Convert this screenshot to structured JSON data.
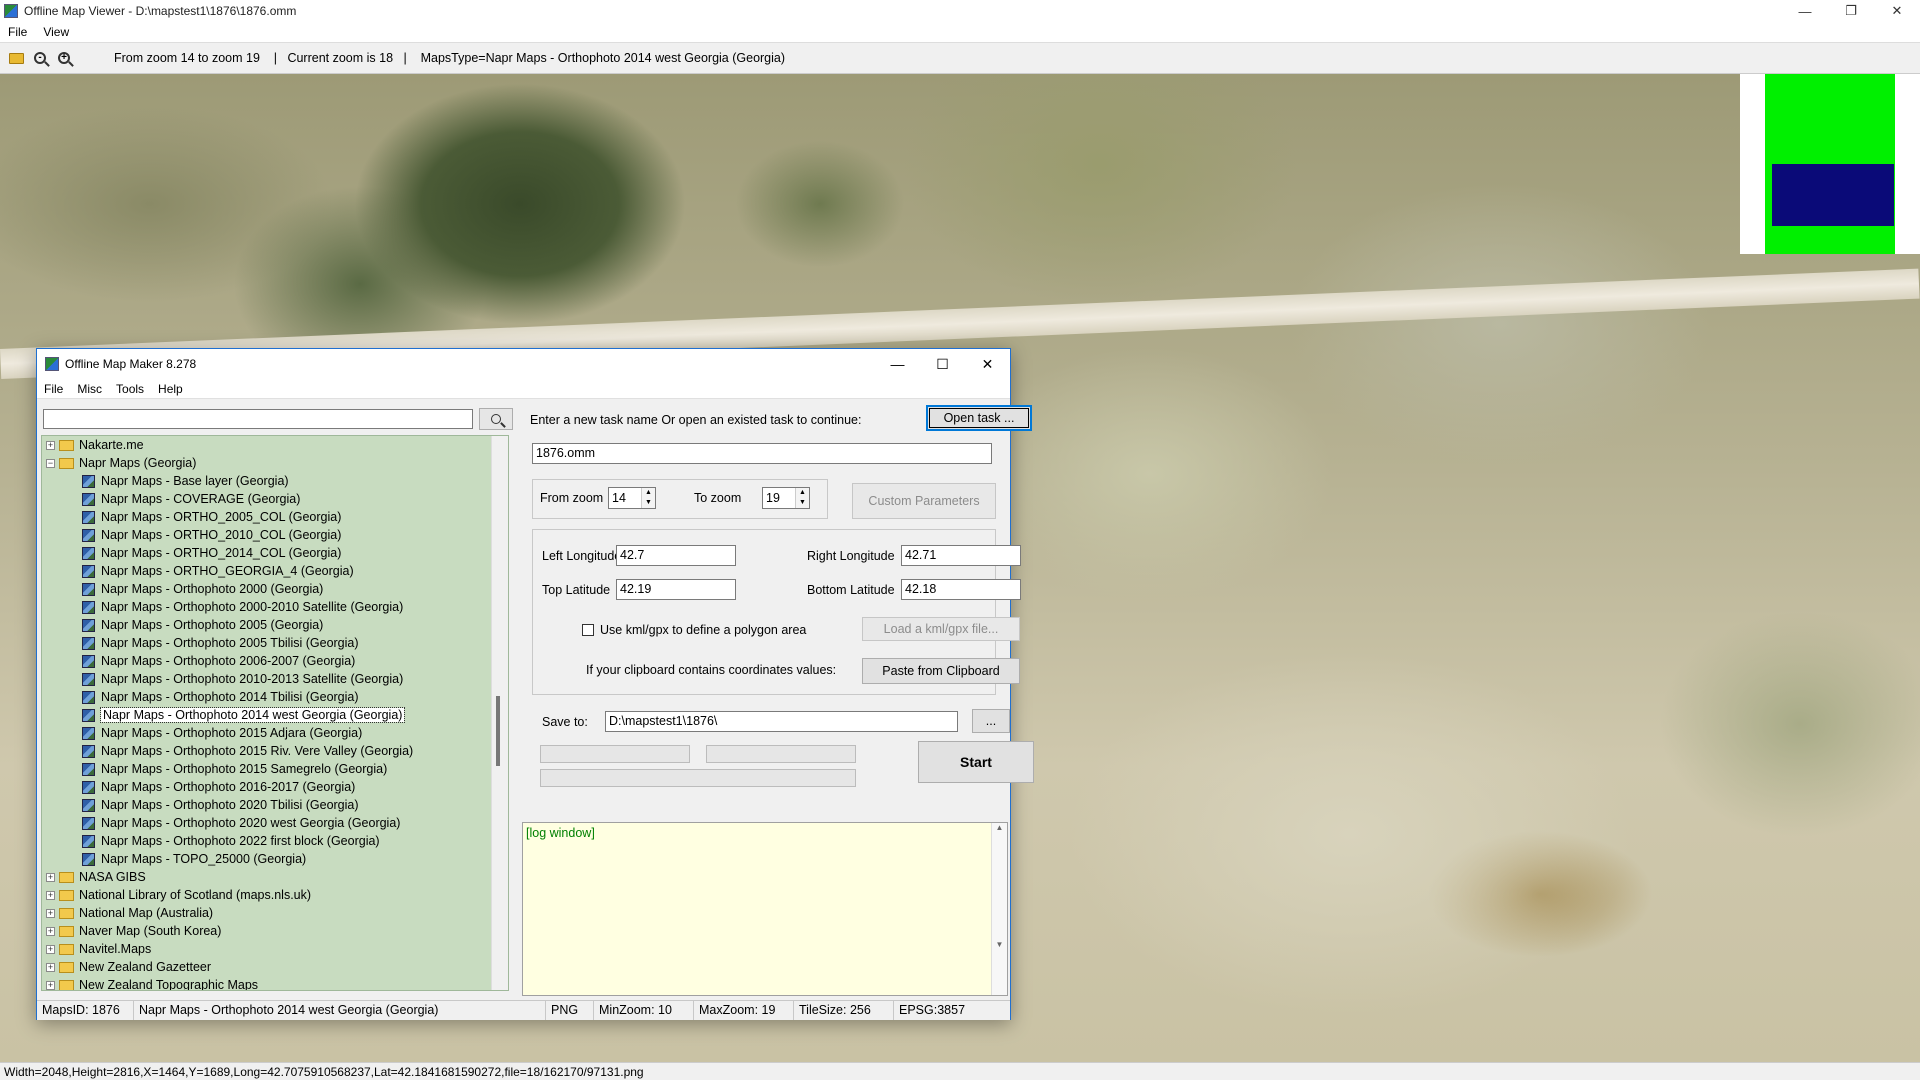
{
  "viewer": {
    "title": "Offline Map Viewer - D:\\mapstest1\\1876\\1876.omm",
    "menu": [
      "File",
      "View"
    ],
    "toolbar_info": "From zoom 14 to zoom 19    |   Current zoom is 18   |    MapsType=Napr Maps - Orthophoto 2014 west Georgia (Georgia)",
    "zoom_out_icon": "zoom-out-icon",
    "zoom_in_icon": "zoom-in-icon",
    "status": "Width=2048,Height=2816,X=1464,Y=1689,Long=42.7075910568237,Lat=42.1841681590272,file=18/162170/97131.png",
    "minimap_colors": {
      "viewport": "#00f000",
      "current": "#0a0a78"
    }
  },
  "dialog": {
    "title": "Offline Map Maker 8.278",
    "menu": [
      "File",
      "Misc",
      "Tools",
      "Help"
    ],
    "search": {
      "value": ""
    },
    "tree": {
      "folders_before": [
        {
          "label": "Nakarte.me",
          "expanded": false
        }
      ],
      "open_folder": {
        "label": "Napr Maps (Georgia)",
        "expanded": true
      },
      "children": [
        "Napr Maps - Base layer (Georgia)",
        "Napr Maps - COVERAGE (Georgia)",
        "Napr Maps - ORTHO_2005_COL (Georgia)",
        "Napr Maps - ORTHO_2010_COL (Georgia)",
        "Napr Maps - ORTHO_2014_COL (Georgia)",
        "Napr Maps - ORTHO_GEORGIA_4 (Georgia)",
        "Napr Maps - Orthophoto 2000 (Georgia)",
        "Napr Maps - Orthophoto 2000-2010 Satellite (Georgia)",
        "Napr Maps - Orthophoto 2005 (Georgia)",
        "Napr Maps - Orthophoto 2005 Tbilisi (Georgia)",
        "Napr Maps - Orthophoto 2006-2007 (Georgia)",
        "Napr Maps - Orthophoto 2010-2013 Satellite (Georgia)",
        "Napr Maps - Orthophoto 2014 Tbilisi (Georgia)",
        "Napr Maps - Orthophoto 2014 west Georgia (Georgia)",
        "Napr Maps - Orthophoto 2015 Adjara (Georgia)",
        "Napr Maps - Orthophoto 2015 Riv. Vere Valley (Georgia)",
        "Napr Maps - Orthophoto 2015 Samegrelo (Georgia)",
        "Napr Maps - Orthophoto 2016-2017 (Georgia)",
        "Napr Maps - Orthophoto 2020 Tbilisi (Georgia)",
        "Napr Maps - Orthophoto 2020 west Georgia (Georgia)",
        "Napr Maps - Orthophoto 2022 first block (Georgia)",
        "Napr Maps - TOPO_25000 (Georgia)"
      ],
      "selected_index": 13,
      "folders_after": [
        "NASA GIBS",
        "National Library of Scotland (maps.nls.uk)",
        "National Map (Australia)",
        "Naver Map (South Korea)",
        "Navitel.Maps",
        "New Zealand Gazetteer",
        "New Zealand Topographic Maps"
      ]
    },
    "task": {
      "prompt": "Enter a new task name Or open an existed task to continue:",
      "open_button": "Open task ...",
      "name": "1876.omm"
    },
    "zoom": {
      "from_label": "From zoom",
      "from_value": "14",
      "to_label": "To zoom",
      "to_value": "19",
      "custom_button": "Custom Parameters"
    },
    "coords": {
      "left_label": "Left Longitude",
      "left_value": "42.7",
      "right_label": "Right Longitude",
      "right_value": "42.71",
      "top_label": "Top Latitude",
      "top_value": "42.19",
      "bottom_label": "Bottom Latitude",
      "bottom_value": "42.18",
      "kml_label": "Use kml/gpx to define a polygon area",
      "kml_checked": false,
      "load_button": "Load a kml/gpx file...",
      "clipboard_label": "If your clipboard contains coordinates values:",
      "paste_button": "Paste from Clipboard"
    },
    "save": {
      "label": "Save to:",
      "path": "D:\\mapstest1\\1876\\",
      "browse": "...",
      "start": "Start"
    },
    "log": "[log window]",
    "status": {
      "mapsid": "MapsID: 1876",
      "name": "Napr Maps - Orthophoto 2014 west Georgia (Georgia)",
      "format": "PNG",
      "minzoom": "MinZoom: 10",
      "maxzoom": "MaxZoom: 19",
      "tilesize": "TileSize: 256",
      "epsg": "EPSG:3857"
    }
  }
}
